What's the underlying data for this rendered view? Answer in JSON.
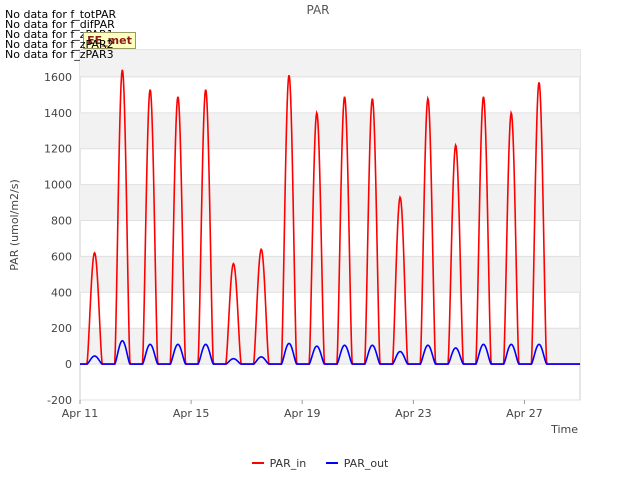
{
  "notes": [
    "No data for f_totPAR",
    "No data for f_difPAR",
    "No data for f_zPAR1",
    "No data for f_zPAR2",
    "No data for f_zPAR3"
  ],
  "badge_label": "EE_met",
  "colors": {
    "par_in": "#ff0000",
    "par_out": "#0000ff"
  },
  "chart_data": {
    "type": "line",
    "title": "PAR",
    "xlabel": "Time",
    "ylabel": "PAR (umol/m2/s)",
    "ylim": [
      -200,
      1750
    ],
    "xlim": [
      "2024-04-11",
      "2024-04-29"
    ],
    "x_ticks": [
      "Apr 11",
      "Apr 15",
      "Apr 19",
      "Apr 23",
      "Apr 27"
    ],
    "y_ticks": [
      -200,
      0,
      200,
      400,
      600,
      800,
      1000,
      1200,
      1400,
      1600
    ],
    "grid": true,
    "legend": "bottom-center",
    "series": [
      {
        "name": "PAR_in",
        "daily_peak_dates": [
          "2024-04-11",
          "2024-04-12",
          "2024-04-13",
          "2024-04-14",
          "2024-04-15",
          "2024-04-16",
          "2024-04-17",
          "2024-04-18",
          "2024-04-19",
          "2024-04-20",
          "2024-04-21",
          "2024-04-22",
          "2024-04-23",
          "2024-04-24",
          "2024-04-25",
          "2024-04-26",
          "2024-04-27",
          "2024-04-28"
        ],
        "daily_peak_values": [
          620,
          1640,
          1530,
          1490,
          1530,
          560,
          640,
          1610,
          1400,
          1490,
          1480,
          930,
          1480,
          1220,
          1490,
          1400,
          1570,
          0
        ]
      },
      {
        "name": "PAR_out",
        "daily_peak_dates": [
          "2024-04-11",
          "2024-04-12",
          "2024-04-13",
          "2024-04-14",
          "2024-04-15",
          "2024-04-16",
          "2024-04-17",
          "2024-04-18",
          "2024-04-19",
          "2024-04-20",
          "2024-04-21",
          "2024-04-22",
          "2024-04-23",
          "2024-04-24",
          "2024-04-25",
          "2024-04-26",
          "2024-04-27",
          "2024-04-28"
        ],
        "daily_peak_values": [
          45,
          130,
          110,
          110,
          110,
          30,
          40,
          115,
          100,
          105,
          105,
          70,
          105,
          90,
          110,
          110,
          110,
          0
        ]
      }
    ]
  }
}
